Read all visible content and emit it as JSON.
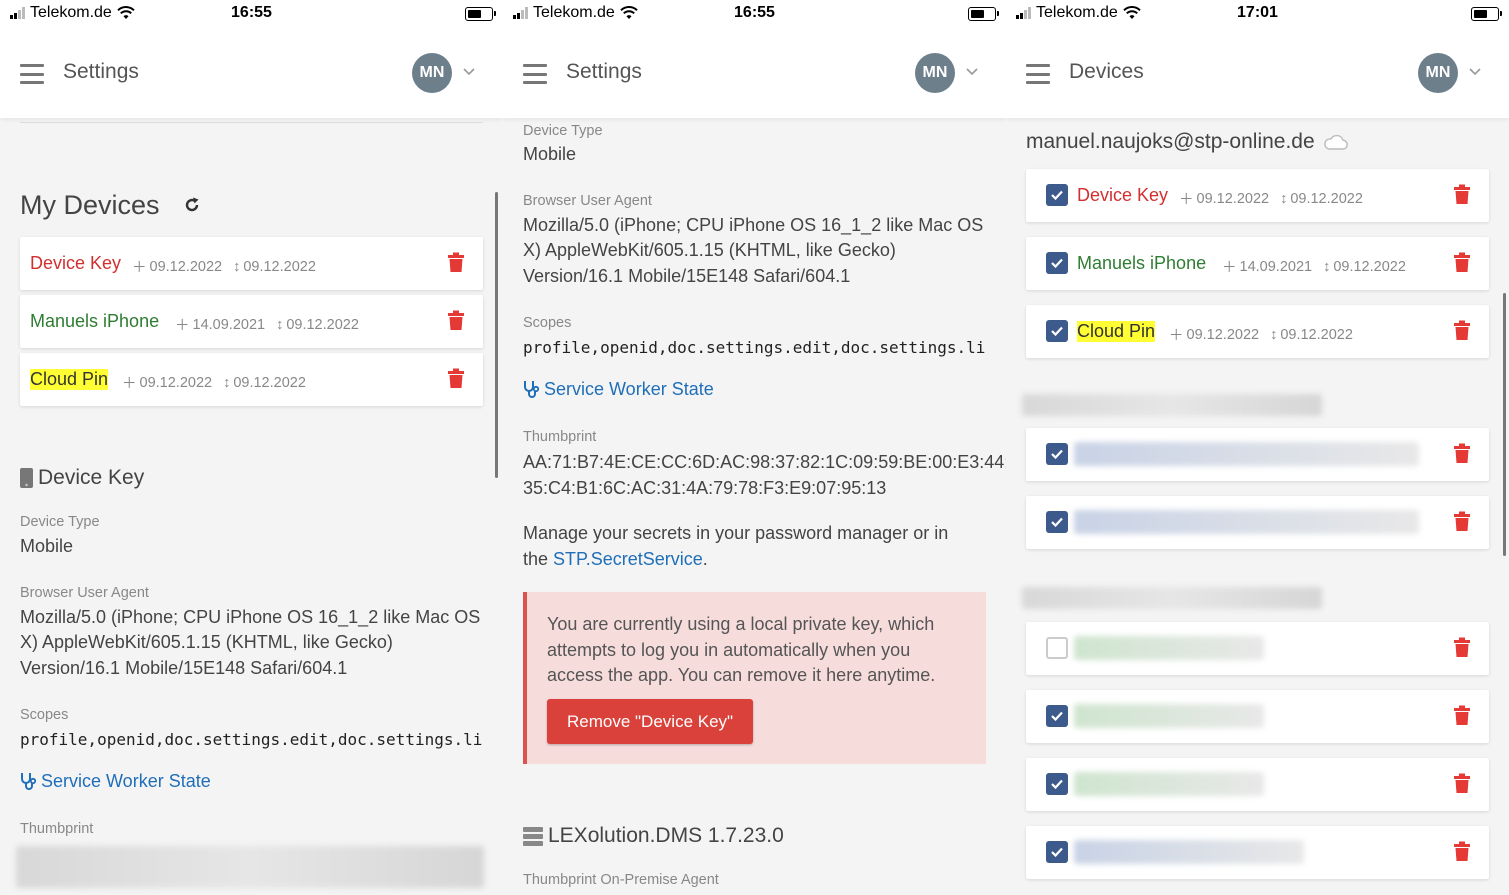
{
  "screens": [
    {
      "status": {
        "carrier": "Telekom.de",
        "time": "16:55"
      },
      "appbar": {
        "title": "Settings",
        "avatar": "MN"
      },
      "devices_heading": "My Devices",
      "devices": [
        {
          "name": "Device Key",
          "created": "09.12.2022",
          "used": "09.12.2022"
        },
        {
          "name": "Manuels iPhone",
          "created": "14.09.2021",
          "used": "09.12.2022"
        },
        {
          "name": "Cloud Pin",
          "created": "09.12.2022",
          "used": "09.12.2022"
        }
      ],
      "detail_heading": "Device Key",
      "device_type_label": "Device Type",
      "device_type": "Mobile",
      "ua_label": "Browser User Agent",
      "ua_lines": [
        "Mozilla/5.0 (iPhone; CPU iPhone OS 16_1_2 like Mac OS",
        "X) AppleWebKit/605.1.15 (KHTML, like Gecko)",
        "Version/16.1 Mobile/15E148 Safari/604.1"
      ],
      "scopes_label": "Scopes",
      "scopes": "profile,openid,doc.settings.edit,doc.settings.li",
      "sw_link": "Service Worker State",
      "thumb_label": "Thumbprint"
    },
    {
      "status": {
        "carrier": "Telekom.de",
        "time": "16:55"
      },
      "appbar": {
        "title": "Settings",
        "avatar": "MN"
      },
      "device_type_label": "Device Type",
      "device_type": "Mobile",
      "ua_label": "Browser User Agent",
      "ua_lines": [
        "Mozilla/5.0 (iPhone; CPU iPhone OS 16_1_2 like Mac OS",
        "X) AppleWebKit/605.1.15 (KHTML, like Gecko)",
        "Version/16.1 Mobile/15E148 Safari/604.1"
      ],
      "scopes_label": "Scopes",
      "scopes": "profile,openid,doc.settings.edit,doc.settings.li",
      "sw_link": "Service Worker State",
      "thumb_label": "Thumbprint",
      "thumb_lines": [
        "AA:71:B7:4E:CE:CC:6D:AC:98:37:82:1C:09:59:BE:00:E3:44:",
        "35:C4:B1:6C:AC:31:4A:79:78:F3:E9:07:95:13"
      ],
      "manage_text_1": "Manage your secrets in your password manager or in",
      "manage_text_2a": "the ",
      "manage_link": "STP.SecretService",
      "manage_text_2b": ".",
      "alert_lines": [
        "You are currently using a local private key, which",
        "attempts to log you in automatically when you",
        "access the app. You can remove it here anytime."
      ],
      "alert_button": "Remove \"Device Key\"",
      "dms_heading": "LEXolution.DMS 1.7.23.0",
      "onprem_label": "Thumbprint On-Premise Agent"
    },
    {
      "status": {
        "carrier": "Telekom.de",
        "time": "17:01"
      },
      "appbar": {
        "title": "Devices",
        "avatar": "MN"
      },
      "account": "manuel.naujoks@stp-online.de",
      "devices": [
        {
          "name": "Device Key",
          "created": "09.12.2022",
          "used": "09.12.2022",
          "checked": true
        },
        {
          "name": "Manuels iPhone",
          "created": "14.09.2021",
          "used": "09.12.2022",
          "checked": true
        },
        {
          "name": "Cloud Pin",
          "created": "09.12.2022",
          "used": "09.12.2022",
          "checked": true
        }
      ],
      "redacted_rows_checked": [
        true,
        true,
        false,
        true,
        true,
        true
      ]
    }
  ],
  "colors": {
    "danger": "#d32f2f",
    "success": "#2e7d32",
    "link": "#1f6eb8",
    "checkbox": "#3d5a8c",
    "highlight": "#ffff33"
  }
}
